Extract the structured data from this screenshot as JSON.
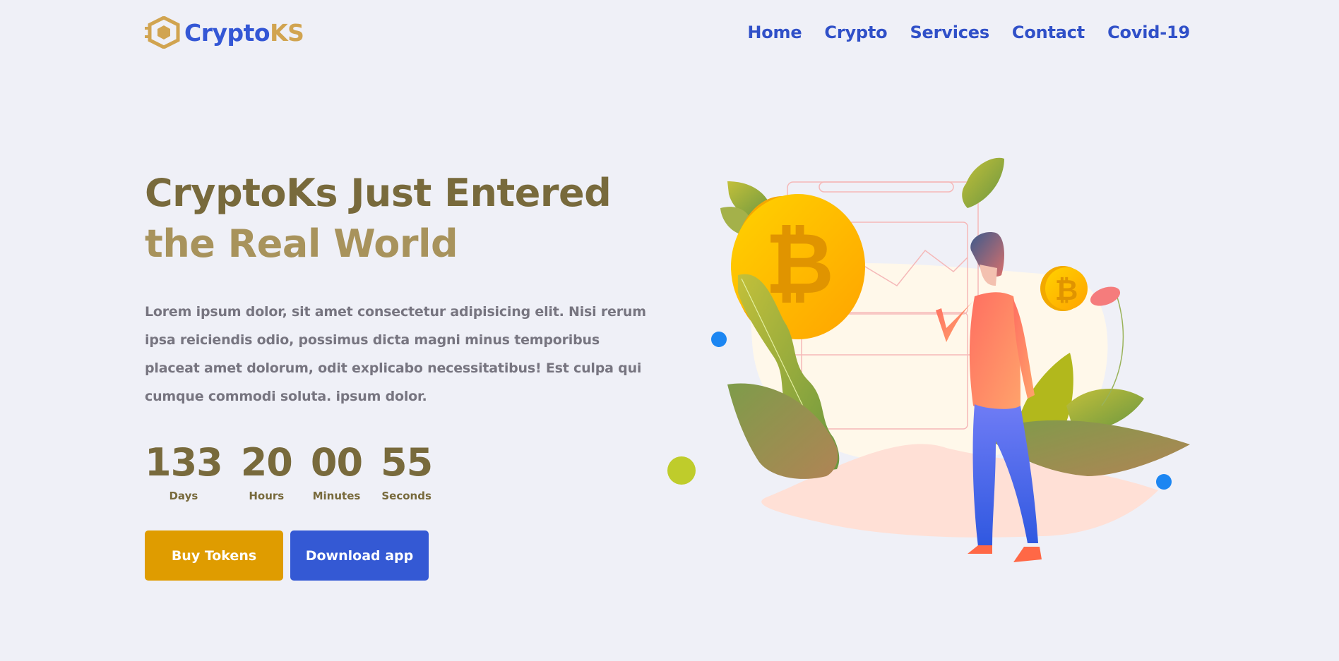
{
  "brand": {
    "name_part1": "Crypto",
    "name_part2": "KS"
  },
  "nav": {
    "items": [
      {
        "label": "Home"
      },
      {
        "label": "Crypto"
      },
      {
        "label": "Services"
      },
      {
        "label": "Contact"
      },
      {
        "label": "Covid-19"
      }
    ]
  },
  "hero": {
    "title_dark": "CryptoKs Just Entered ",
    "title_light": "the Real World",
    "description": "Lorem ipsum dolor, sit amet consectetur adipisicing elit. Nisi rerum ipsa reiciendis odio, possimus dicta magni minus temporibus placeat amet dolorum, odit explicabo necessitatibus! Est culpa qui cumque commodi soluta. ipsum dolor."
  },
  "countdown": [
    {
      "value": "133",
      "label": "Days"
    },
    {
      "value": "20",
      "label": "Hours"
    },
    {
      "value": "00",
      "label": "Minutes"
    },
    {
      "value": "55",
      "label": "Seconds"
    }
  ],
  "actions": {
    "buy_label": "Buy Tokens",
    "download_label": "Download app"
  },
  "colors": {
    "background": "#eff0f7",
    "brand_blue": "#3457d5",
    "brand_gold": "#d1a450",
    "title_dark": "#786a3c",
    "title_light": "#a8935c",
    "button_gold": "#df9c00",
    "button_blue": "#3459d4"
  },
  "illustration": {
    "icon": "bitcoin-coin-icon"
  }
}
